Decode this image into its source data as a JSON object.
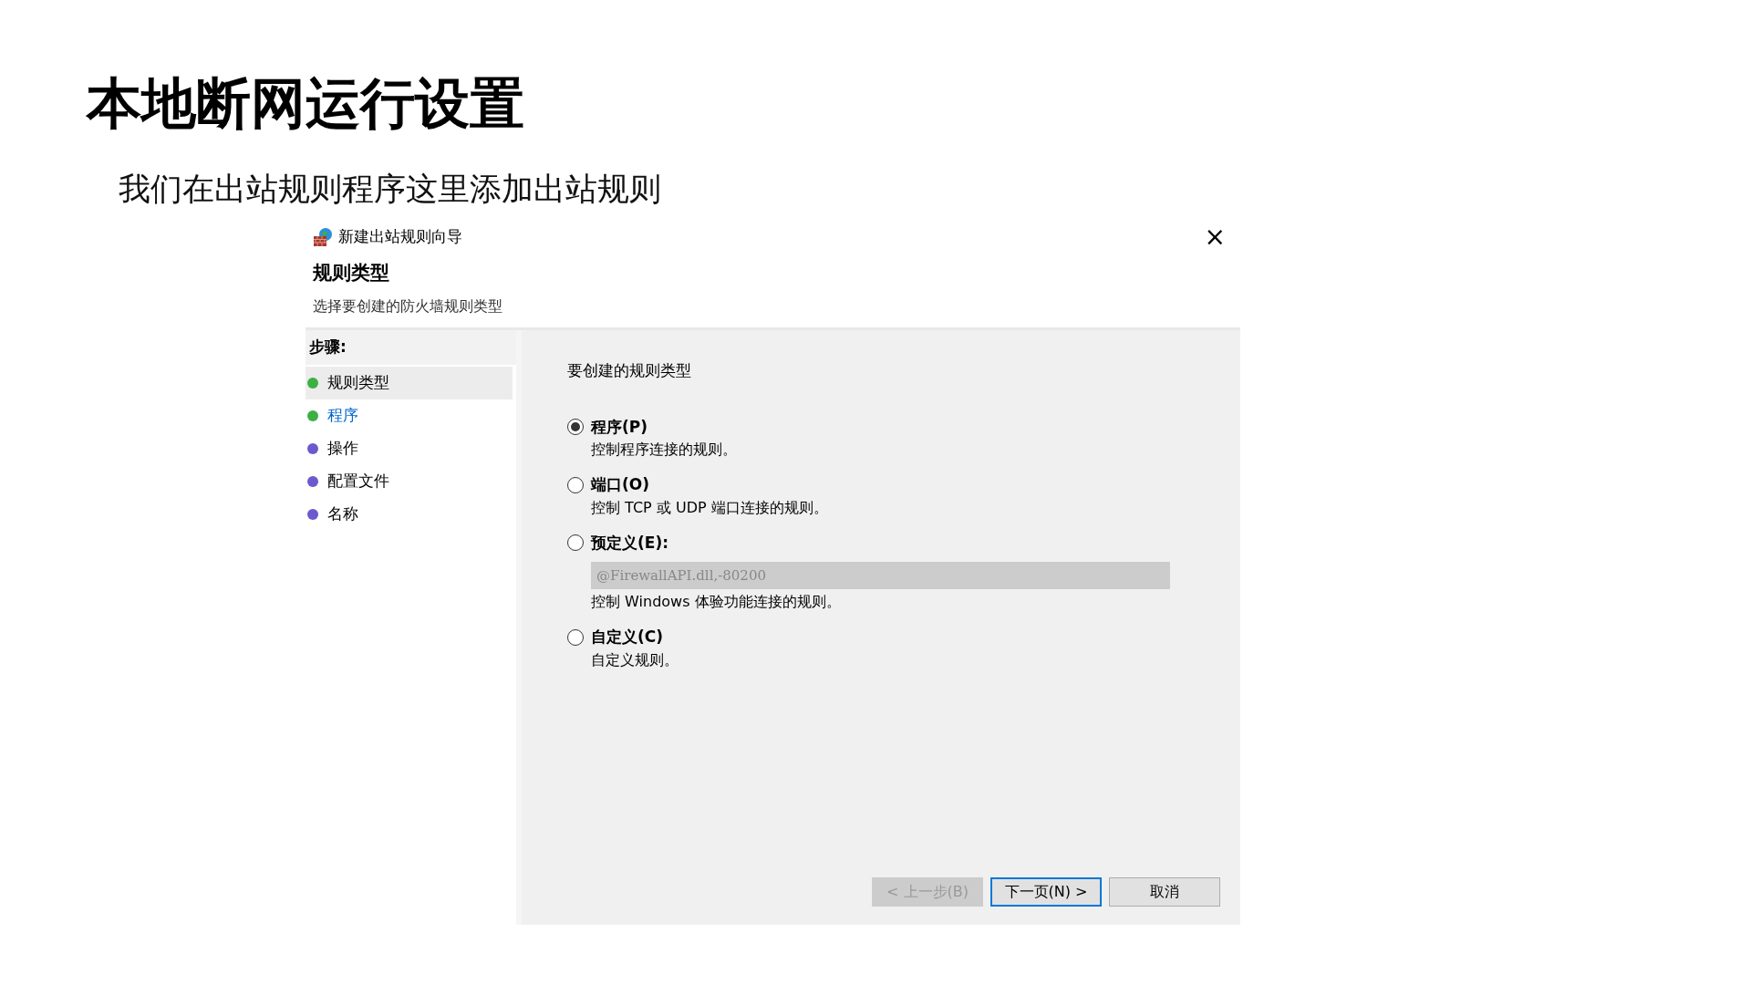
{
  "slide": {
    "title": "本地断网运行设置",
    "subtitle": "我们在出站规则程序这里添加出站规则"
  },
  "window": {
    "title": "新建出站规则向导",
    "close": "×"
  },
  "header": {
    "heading": "规则类型",
    "description": "选择要创建的防火墙规则类型"
  },
  "steps": {
    "label": "步骤:",
    "items": [
      {
        "label": "规则类型",
        "selected": true,
        "link": false,
        "color": "#3cb043"
      },
      {
        "label": "程序",
        "selected": false,
        "link": true,
        "color": "#3cb043"
      },
      {
        "label": "操作",
        "selected": false,
        "link": false,
        "color": "#6a5acd"
      },
      {
        "label": "配置文件",
        "selected": false,
        "link": false,
        "color": "#6a5acd"
      },
      {
        "label": "名称",
        "selected": false,
        "link": false,
        "color": "#6a5acd"
      }
    ]
  },
  "question": "要创建的规则类型",
  "options": [
    {
      "kind": "radio",
      "label": "程序(P)",
      "description": "控制程序连接的规则。",
      "selected": true
    },
    {
      "kind": "radio",
      "label": "端口(O)",
      "description": "控制 TCP 或 UDP 端口连接的规则。",
      "selected": false
    },
    {
      "kind": "radio-dropdown",
      "label": "预定义(E):",
      "dropdown": {
        "value": "@FirewallAPI.dll,-80200",
        "disabled": true
      },
      "description": "控制 Windows 体验功能连接的规则。",
      "selected": false
    },
    {
      "kind": "radio",
      "label": "自定义(C)",
      "description": "自定义规则。",
      "selected": false
    }
  ],
  "buttons": [
    {
      "label": "< 上一步(B)",
      "disabled": true,
      "default": false
    },
    {
      "label": "下一页(N) >",
      "disabled": false,
      "default": true
    },
    {
      "label": "取消",
      "disabled": false,
      "default": false
    }
  ]
}
